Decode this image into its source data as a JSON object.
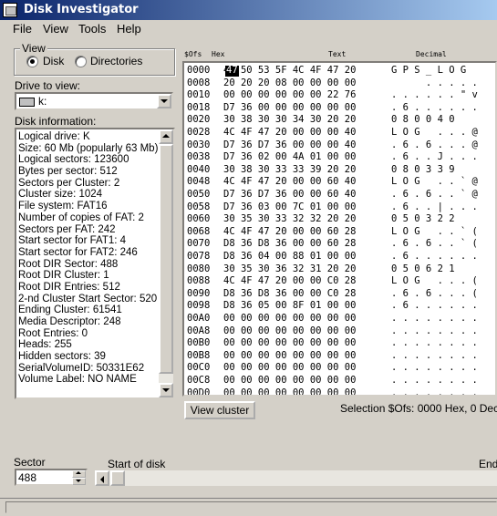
{
  "window": {
    "title": "Disk Investigator"
  },
  "menu": [
    "File",
    "View",
    "Tools",
    "Help"
  ],
  "view_group": {
    "legend": "View",
    "options": [
      "Disk",
      "Directories"
    ],
    "selected": "Disk"
  },
  "drive": {
    "label": "Drive to view:",
    "value": "k:"
  },
  "disk_info": {
    "label": "Disk information:",
    "lines": [
      "Logical drive: K",
      "Size: 60 Mb (popularly 63 Mb)",
      "Logical sectors: 123600",
      "Bytes per sector: 512",
      "Sectors per Cluster: 2",
      "Cluster size: 1024",
      "File system: FAT16",
      "Number of copies of FAT: 2",
      "Sectors per FAT: 242",
      "Start sector for FAT1: 4",
      "Start sector for FAT2: 246",
      "Root DIR Sector: 488",
      "Root DIR Cluster: 1",
      "Root DIR Entries: 512",
      "2-nd Cluster Start Sector: 520",
      "Ending Cluster: 61541",
      "Media Descriptor: 248",
      "Root Entries: 0",
      "Heads: 255",
      "Hidden sectors: 39",
      "SerialVolumeID: 50331E62",
      "Volume Label: NO NAME"
    ]
  },
  "hex_view": {
    "headers": {
      "offset": "$Ofs",
      "hex": "Hex",
      "text": "Text",
      "decimal": "Decimal"
    },
    "selected_byte": "47",
    "rows": [
      {
        "offset": "0000",
        "hex": "47 50 53 5F 4C 4F 47 20",
        "text": "G P S _ L O G  "
      },
      {
        "offset": "0008",
        "hex": "20 20 20 08 00 00 00 00",
        "text": "      . . . . ."
      },
      {
        "offset": "0010",
        "hex": "00 00 00 00 00 00 22 76",
        "text": ". . . . . . \" v"
      },
      {
        "offset": "0018",
        "hex": "D7 36 00 00 00 00 00 00",
        "text": ". 6 . . . . . ."
      },
      {
        "offset": "0020",
        "hex": "30 38 30 30 34 30 20 20",
        "text": "0 8 0 0 4 0    "
      },
      {
        "offset": "0028",
        "hex": "4C 4F 47 20 00 00 00 40",
        "text": "L O G   . . . @"
      },
      {
        "offset": "0030",
        "hex": "D7 36 D7 36 00 00 00 40",
        "text": ". 6 . 6 . . . @"
      },
      {
        "offset": "0038",
        "hex": "D7 36 02 00 4A 01 00 00",
        "text": ". 6 . . J . . ."
      },
      {
        "offset": "0040",
        "hex": "30 38 30 33 33 39 20 20",
        "text": "0 8 0 3 3 9    "
      },
      {
        "offset": "0048",
        "hex": "4C 4F 47 20 00 00 60 40",
        "text": "L O G   . . ` @"
      },
      {
        "offset": "0050",
        "hex": "D7 36 D7 36 00 00 60 40",
        "text": ". 6 . 6 . . ` @"
      },
      {
        "offset": "0058",
        "hex": "D7 36 03 00 7C 01 00 00",
        "text": ". 6 . . | . . ."
      },
      {
        "offset": "0060",
        "hex": "30 35 30 33 32 32 20 20",
        "text": "0 5 0 3 2 2    "
      },
      {
        "offset": "0068",
        "hex": "4C 4F 47 20 00 00 60 28",
        "text": "L O G   . . ` ("
      },
      {
        "offset": "0070",
        "hex": "D8 36 D8 36 00 00 60 28",
        "text": ". 6 . 6 . . ` ("
      },
      {
        "offset": "0078",
        "hex": "D8 36 04 00 88 01 00 00",
        "text": ". 6 . . . . . ."
      },
      {
        "offset": "0080",
        "hex": "30 35 30 36 32 31 20 20",
        "text": "0 5 0 6 2 1    "
      },
      {
        "offset": "0088",
        "hex": "4C 4F 47 20 00 00 C0 28",
        "text": "L O G   . . . ("
      },
      {
        "offset": "0090",
        "hex": "D8 36 D8 36 00 00 C0 28",
        "text": ". 6 . 6 . . . ("
      },
      {
        "offset": "0098",
        "hex": "D8 36 05 00 8F 01 00 00",
        "text": ". 6 . . . . . ."
      },
      {
        "offset": "00A0",
        "hex": "00 00 00 00 00 00 00 00",
        "text": ". . . . . . . ."
      },
      {
        "offset": "00A8",
        "hex": "00 00 00 00 00 00 00 00",
        "text": ". . . . . . . ."
      },
      {
        "offset": "00B0",
        "hex": "00 00 00 00 00 00 00 00",
        "text": ". . . . . . . ."
      },
      {
        "offset": "00B8",
        "hex": "00 00 00 00 00 00 00 00",
        "text": ". . . . . . . ."
      },
      {
        "offset": "00C0",
        "hex": "00 00 00 00 00 00 00 00",
        "text": ". . . . . . . ."
      },
      {
        "offset": "00C8",
        "hex": "00 00 00 00 00 00 00 00",
        "text": ". . . . . . . ."
      },
      {
        "offset": "00D0",
        "hex": "00 00 00 00 00 00 00 00",
        "text": ". . . . . . . ."
      }
    ]
  },
  "view_cluster_button": "View cluster",
  "selection": "Selection $Ofs: 0000 Hex,  0 Dec",
  "sector": {
    "label": "Sector",
    "value": "488"
  },
  "disk_position": {
    "start_label": "Start of disk",
    "end_label": "End"
  },
  "colors": {
    "titlebar_start": "#0a246a",
    "titlebar_end": "#a6caf0",
    "face": "#d4d0c8"
  }
}
